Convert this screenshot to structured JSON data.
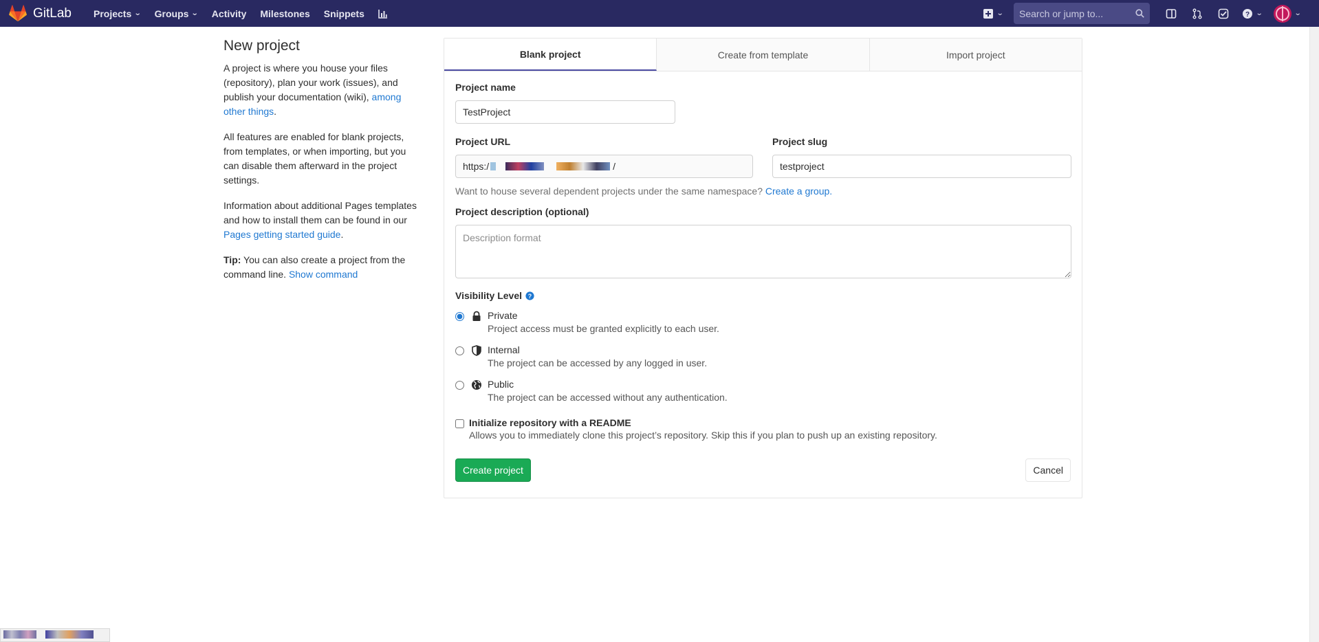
{
  "navbar": {
    "brand": "GitLab",
    "links": [
      {
        "label": "Projects",
        "dropdown": true
      },
      {
        "label": "Groups",
        "dropdown": true
      },
      {
        "label": "Activity",
        "dropdown": false
      },
      {
        "label": "Milestones",
        "dropdown": false
      },
      {
        "label": "Snippets",
        "dropdown": false
      }
    ],
    "search_placeholder": "Search or jump to...",
    "colors": {
      "bg": "#292961",
      "search_bg": "#4a4a85"
    }
  },
  "intro": {
    "title": "New project",
    "p1_text": "A project is where you house your files (repository), plan your work (issues), and publish your documentation (wiki), ",
    "p1_link": "among other things",
    "p1_end": ".",
    "p2": "All features are enabled for blank projects, from templates, or when importing, but you can disable them afterward in the project settings.",
    "p3_text": "Information about additional Pages templates and how to install them can be found in our ",
    "p3_link": "Pages getting started guide",
    "p3_end": ".",
    "tip_label": "Tip:",
    "tip_text": " You can also create a project from the command line. ",
    "tip_link": "Show command"
  },
  "tabs": [
    {
      "label": "Blank project",
      "active": true
    },
    {
      "label": "Create from template",
      "active": false
    },
    {
      "label": "Import project",
      "active": false
    }
  ],
  "form": {
    "project_name_label": "Project name",
    "project_name_value": "TestProject",
    "project_url_label": "Project URL",
    "project_url_value": "https:/",
    "project_slug_label": "Project slug",
    "project_slug_value": "testproject",
    "namespace_hint": "Want to house several dependent projects under the same namespace? ",
    "namespace_link": "Create a group.",
    "description_label": "Project description (optional)",
    "description_placeholder": "Description format",
    "visibility_label": "Visibility Level",
    "visibility_options": [
      {
        "title": "Private",
        "desc": "Project access must be granted explicitly to each user.",
        "checked": true,
        "icon": "lock-icon"
      },
      {
        "title": "Internal",
        "desc": "The project can be accessed by any logged in user.",
        "checked": false,
        "icon": "shield-icon"
      },
      {
        "title": "Public",
        "desc": "The project can be accessed without any authentication.",
        "checked": false,
        "icon": "globe-icon"
      }
    ],
    "readme_label": "Initialize repository with a README",
    "readme_desc": "Allows you to immediately clone this project’s repository. Skip this if you plan to push up an existing repository.",
    "create_button": "Create project",
    "cancel_button": "Cancel",
    "colors": {
      "primary": "#1aaa55",
      "link": "#1f78d1",
      "tab_active_border": "#4b4ba3"
    }
  }
}
